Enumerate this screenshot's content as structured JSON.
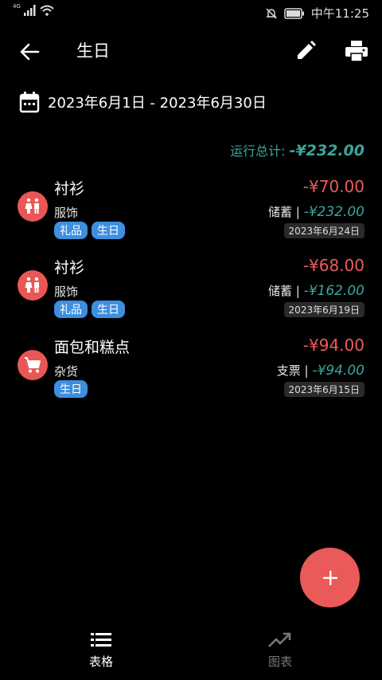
{
  "status_bar": {
    "network": "4G",
    "time": "中午11:25"
  },
  "toolbar": {
    "title": "生日"
  },
  "date_range": "2023年6月1日 - 2023年6月30日",
  "running_total": {
    "label": "运行总计:",
    "value": "-¥232.00"
  },
  "transactions": [
    {
      "name": "衬衫",
      "category": "服饰",
      "tags": [
        "礼品",
        "生日"
      ],
      "amount": "-¥70.00",
      "account": "储蓄 |",
      "balance": "-¥232.00",
      "date": "2023年6月24日",
      "icon": "restroom-icon"
    },
    {
      "name": "衬衫",
      "category": "服饰",
      "tags": [
        "礼品",
        "生日"
      ],
      "amount": "-¥68.00",
      "account": "储蓄 |",
      "balance": "-¥162.00",
      "date": "2023年6月19日",
      "icon": "restroom-icon"
    },
    {
      "name": "面包和糕点",
      "category": "杂货",
      "tags": [
        "生日"
      ],
      "amount": "-¥94.00",
      "account": "支票 |",
      "balance": "-¥94.00",
      "date": "2023年6月15日",
      "icon": "cart-icon"
    }
  ],
  "bottom_nav": {
    "table_label": "表格",
    "chart_label": "图表"
  },
  "colors": {
    "accent_red": "#ea5a58",
    "teal": "#3aa79a",
    "tag_blue": "#3d8fe0",
    "background": "#000000"
  }
}
